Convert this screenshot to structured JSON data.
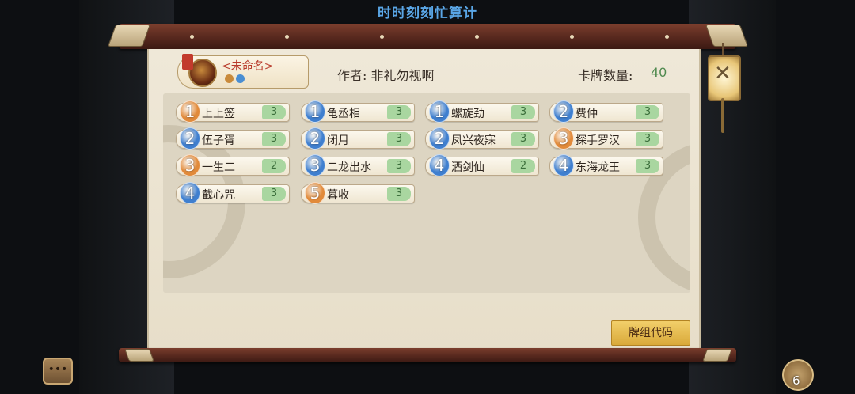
{
  "window_title": "时时刻刻忙算计",
  "deck": {
    "name": "<未命名>",
    "author_label": "作者:",
    "author_name": "非礼勿视啊",
    "count_label": "卡牌数量:",
    "count_value": "40",
    "code_button": "牌组代码"
  },
  "colors": {
    "cost_orange": "#e18a3a",
    "cost_blue": "#3f7fcf",
    "qty_green": "#a9d6a0",
    "accent_gold": "#e0b44d"
  },
  "cards": [
    {
      "cost": "1",
      "name": "上上签",
      "qty": "3",
      "color": "#e18a3a"
    },
    {
      "cost": "1",
      "name": "龟丞相",
      "qty": "3",
      "color": "#3f7fcf"
    },
    {
      "cost": "1",
      "name": "螺旋劲",
      "qty": "3",
      "color": "#3f7fcf"
    },
    {
      "cost": "2",
      "name": "费仲",
      "qty": "3",
      "color": "#3f7fcf"
    },
    {
      "cost": "2",
      "name": "伍子胥",
      "qty": "3",
      "color": "#3f7fcf"
    },
    {
      "cost": "2",
      "name": "闭月",
      "qty": "3",
      "color": "#3f7fcf"
    },
    {
      "cost": "2",
      "name": "凤兴夜寐",
      "qty": "3",
      "color": "#3f7fcf"
    },
    {
      "cost": "3",
      "name": "探手罗汉",
      "qty": "3",
      "color": "#e18a3a"
    },
    {
      "cost": "3",
      "name": "一生二",
      "qty": "2",
      "color": "#e18a3a"
    },
    {
      "cost": "3",
      "name": "二龙出水",
      "qty": "3",
      "color": "#3f7fcf"
    },
    {
      "cost": "4",
      "name": "酒剑仙",
      "qty": "2",
      "color": "#3f7fcf"
    },
    {
      "cost": "4",
      "name": "东海龙王",
      "qty": "3",
      "color": "#3f7fcf"
    },
    {
      "cost": "4",
      "name": "截心咒",
      "qty": "3",
      "color": "#3f7fcf"
    },
    {
      "cost": "5",
      "name": "暮收",
      "qty": "3",
      "color": "#e18a3a"
    }
  ],
  "icons": {
    "close": "close-icon",
    "chat": "chat-icon",
    "bag": "bag-icon"
  },
  "bag_count": "6"
}
